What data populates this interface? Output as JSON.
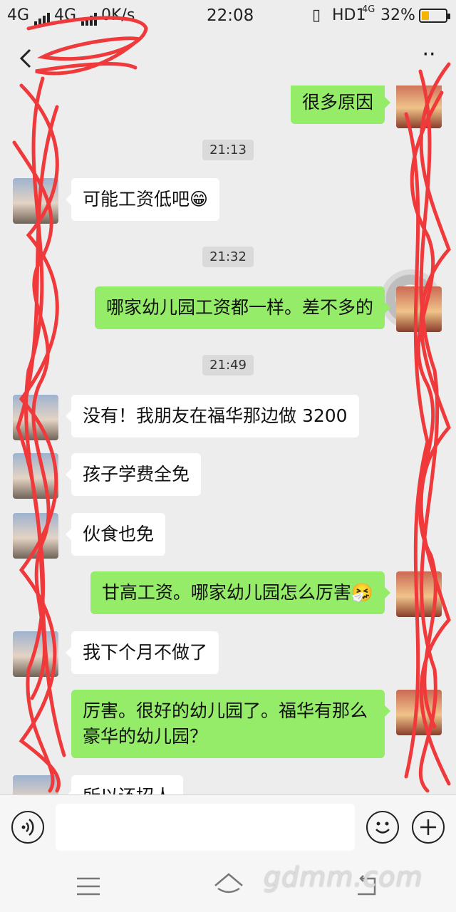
{
  "status_bar": {
    "sim1": "4G",
    "sim2": "4G",
    "speed": "0K/s",
    "time": "22:08",
    "hd": "HD1",
    "net": "4G",
    "battery": "32%",
    "battery_level": 0.32
  },
  "header": {
    "title": "",
    "back_icon": "chevron-left-icon",
    "more_icon": "more-dots-icon"
  },
  "messages": [
    {
      "side": "right",
      "text": "很多原因"
    },
    {
      "type": "time",
      "text": "21:13"
    },
    {
      "side": "left",
      "text": "可能工资低吧😁"
    },
    {
      "type": "time",
      "text": "21:32"
    },
    {
      "side": "right",
      "text": "哪家幼儿园工资都一样。差不多的"
    },
    {
      "type": "time",
      "text": "21:49"
    },
    {
      "side": "left",
      "text": "没有！我朋友在福华那边做 3200"
    },
    {
      "side": "left",
      "text": "孩子学费全免"
    },
    {
      "side": "left",
      "text": "伙食也免"
    },
    {
      "side": "right",
      "text": "甘高工资。哪家幼儿园怎么厉害🤧"
    },
    {
      "side": "left",
      "text": "我下个月不做了"
    },
    {
      "side": "right",
      "text": "厉害。很好的幼儿园了。福华有那么豪华的幼儿园？"
    },
    {
      "side": "left",
      "text": "所以还招人"
    }
  ],
  "input_bar": {
    "voice_icon": "voice-icon",
    "emoji_icon": "smile-icon",
    "plus_icon": "plus-icon",
    "placeholder": ""
  },
  "nav_bar": {
    "menu_icon": "menu-icon",
    "home_icon": "home-icon",
    "back_icon": "back-icon"
  },
  "watermark": "gdmm.com",
  "colors": {
    "background": "#ededed",
    "sent_bubble": "#95ec69",
    "received_bubble": "#ffffff",
    "scribble": "#f0393b"
  }
}
